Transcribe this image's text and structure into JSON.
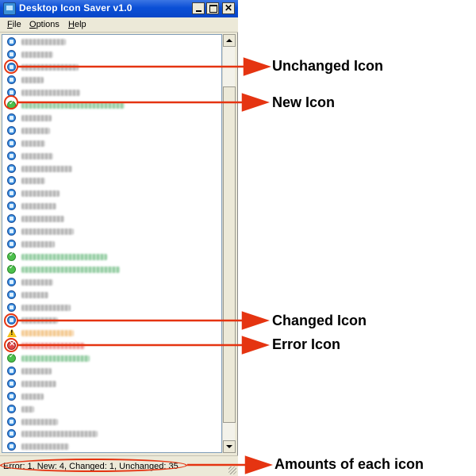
{
  "window": {
    "title": "Desktop Icon Saver v1.0",
    "close_glyph": "✕"
  },
  "menu": [
    {
      "label_u": "F",
      "label_rest": "ile"
    },
    {
      "label_u": "O",
      "label_rest": "ptions"
    },
    {
      "label_u": "H",
      "label_rest": "elp"
    }
  ],
  "list": {
    "rows": [
      {
        "status": "unchanged",
        "w": 56
      },
      {
        "status": "unchanged",
        "w": 40
      },
      {
        "status": "unchanged",
        "w": 72
      },
      {
        "status": "unchanged",
        "w": 28
      },
      {
        "status": "unchanged",
        "w": 74
      },
      {
        "status": "new",
        "w": 130
      },
      {
        "status": "unchanged",
        "w": 38
      },
      {
        "status": "unchanged",
        "w": 36
      },
      {
        "status": "unchanged",
        "w": 30
      },
      {
        "status": "unchanged",
        "w": 40
      },
      {
        "status": "unchanged",
        "w": 64
      },
      {
        "status": "unchanged",
        "w": 30
      },
      {
        "status": "unchanged",
        "w": 48
      },
      {
        "status": "unchanged",
        "w": 44
      },
      {
        "status": "unchanged",
        "w": 54
      },
      {
        "status": "unchanged",
        "w": 66
      },
      {
        "status": "unchanged",
        "w": 42
      },
      {
        "status": "new",
        "w": 108
      },
      {
        "status": "new",
        "w": 124
      },
      {
        "status": "unchanged",
        "w": 40
      },
      {
        "status": "unchanged",
        "w": 34
      },
      {
        "status": "unchanged",
        "w": 62
      },
      {
        "status": "unchanged",
        "w": 46
      },
      {
        "status": "changed",
        "w": 66
      },
      {
        "status": "error",
        "w": 80
      },
      {
        "status": "new",
        "w": 86
      },
      {
        "status": "unchanged",
        "w": 38
      },
      {
        "status": "unchanged",
        "w": 44
      },
      {
        "status": "unchanged",
        "w": 28
      },
      {
        "status": "unchanged",
        "w": 16
      },
      {
        "status": "unchanged",
        "w": 46
      },
      {
        "status": "unchanged",
        "w": 96
      },
      {
        "status": "unchanged",
        "w": 60
      },
      {
        "status": "unchanged",
        "w": 34
      }
    ]
  },
  "status_bar": {
    "text": "Error: 1, New: 4, Changed: 1, Unchanged: 35"
  },
  "annotations": {
    "unchanged": "Unchanged Icon",
    "new": "New Icon",
    "changed": "Changed Icon",
    "error": "Error Icon",
    "amounts": "Amounts of each icon",
    "color": "#e53411"
  },
  "icons": {
    "unchanged": "unchanged-icon",
    "new": "new-icon",
    "changed": "changed-icon",
    "error": "error-icon"
  }
}
